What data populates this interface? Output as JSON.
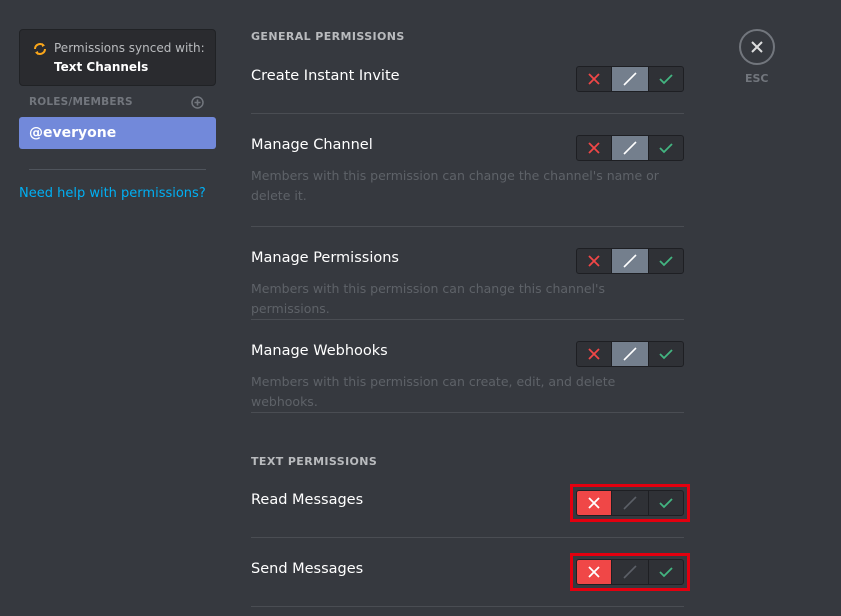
{
  "sidebar": {
    "sync_notice": {
      "line1": "Permissions synced with:",
      "line2": "Text Channels",
      "icon": "sync-icon"
    },
    "roles_header": "ROLES/MEMBERS",
    "add_role_icon": "plus-circle-icon",
    "roles": [
      {
        "label": "@everyone",
        "selected": true
      }
    ],
    "help_link": "Need help with permissions?"
  },
  "close": {
    "icon": "close-icon",
    "label": "ESC"
  },
  "sections": [
    {
      "title": "GENERAL PERMISSIONS",
      "permissions": [
        {
          "name": "Create Instant Invite",
          "description": "",
          "state": "inherit"
        },
        {
          "name": "Manage Channel",
          "description": "Members with this permission can change the channel's name or delete it.",
          "state": "inherit"
        },
        {
          "name": "Manage Permissions",
          "description": "Members with this permission can change this channel's permissions.",
          "state": "inherit"
        },
        {
          "name": "Manage Webhooks",
          "description": "Members with this permission can create, edit, and delete webhooks.",
          "state": "inherit"
        }
      ]
    },
    {
      "title": "TEXT PERMISSIONS",
      "permissions": [
        {
          "name": "Read Messages",
          "description": "",
          "state": "deny",
          "highlighted": true
        },
        {
          "name": "Send Messages",
          "description": "",
          "state": "deny",
          "highlighted": true
        }
      ]
    }
  ],
  "toggle_icons": {
    "deny": "x-icon",
    "inherit": "slash-icon",
    "allow": "check-icon"
  },
  "colors": {
    "accent": "#7289da",
    "deny": "#f04747",
    "allow": "#43b581",
    "link": "#00b0f4",
    "inherit_active": "#747f8d",
    "highlight": "#e3000f",
    "sync": "#faa61a"
  }
}
